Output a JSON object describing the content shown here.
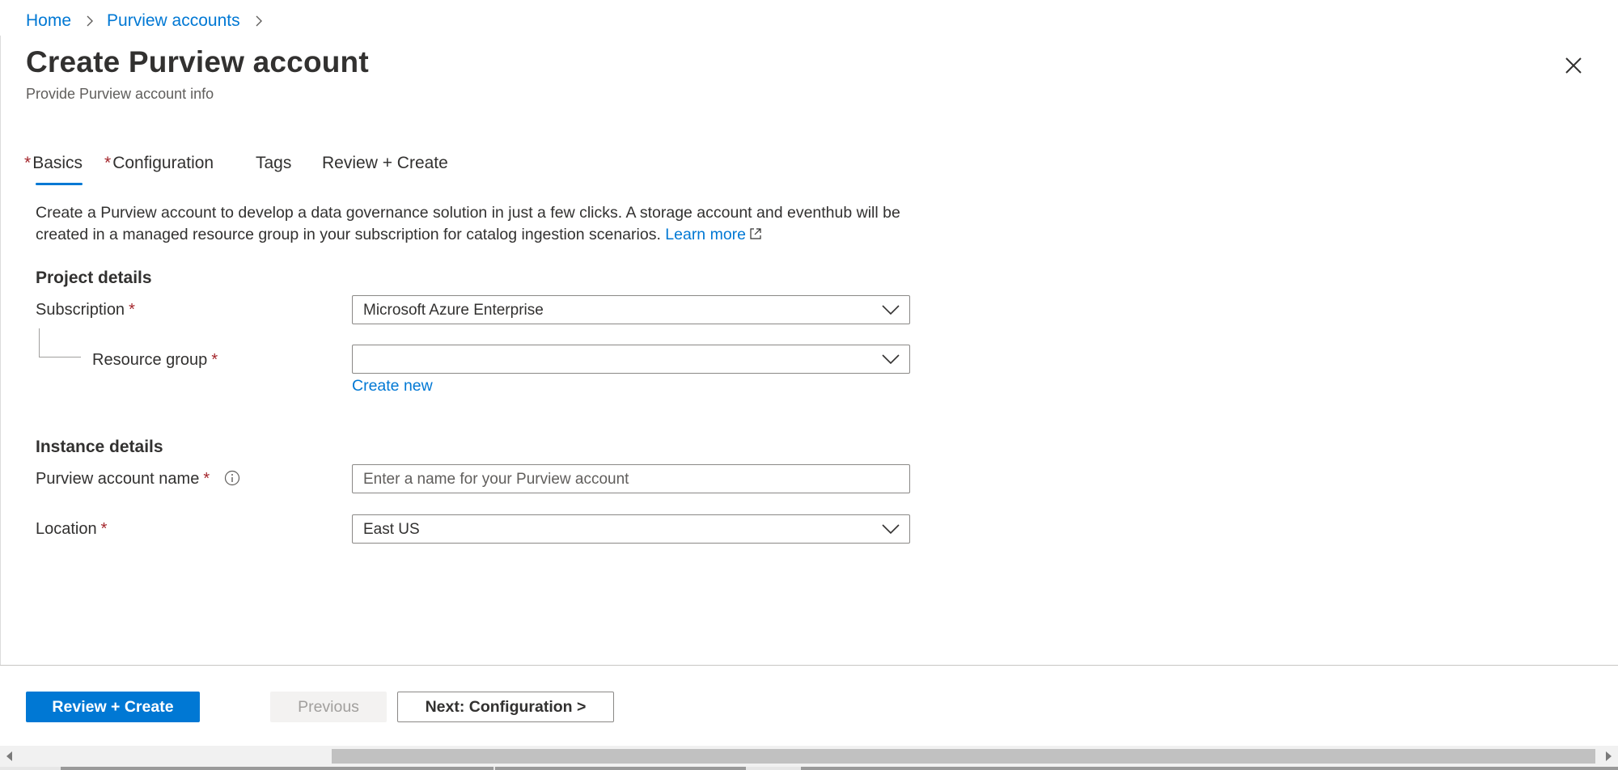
{
  "breadcrumb": {
    "home": "Home",
    "parent": "Purview accounts"
  },
  "header": {
    "title": "Create Purview account",
    "subtitle": "Provide Purview account info"
  },
  "tabs": [
    {
      "label": "Basics",
      "required": true,
      "active": true
    },
    {
      "label": "Configuration",
      "required": true,
      "active": false
    },
    {
      "label": "Tags",
      "required": false,
      "active": false
    },
    {
      "label": "Review + Create",
      "required": false,
      "active": false
    }
  ],
  "intro": {
    "text": "Create a Purview account to develop a data governance solution in just a few clicks. A storage account and eventhub will be created in a managed resource group in your subscription for catalog ingestion scenarios.",
    "link": "Learn more"
  },
  "project_details": {
    "title": "Project details",
    "subscription_label": "Subscription",
    "subscription_value": "Microsoft Azure Enterprise",
    "resource_group_label": "Resource group",
    "resource_group_value": "",
    "create_new": "Create new"
  },
  "instance_details": {
    "title": "Instance details",
    "account_name_label": "Purview account name",
    "account_name_placeholder": "Enter a name for your Purview account",
    "location_label": "Location",
    "location_value": "East US"
  },
  "required_marker": "*",
  "footer": {
    "review_create": "Review + Create",
    "previous": "Previous",
    "next": "Next: Configuration >"
  },
  "colors": {
    "accent": "#0078d4",
    "required": "#a4262c",
    "text": "#323130"
  },
  "icons": [
    "chevron-right-icon",
    "close-icon",
    "external-link-icon",
    "chevron-down-icon",
    "info-icon"
  ]
}
